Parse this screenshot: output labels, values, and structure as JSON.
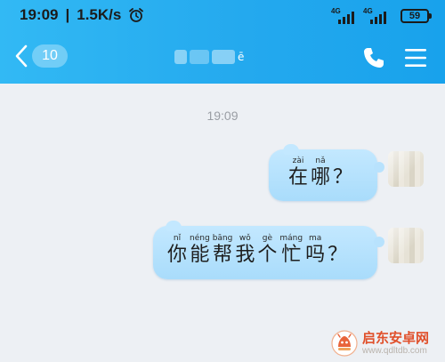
{
  "status_bar": {
    "time": "19:09",
    "speed": "1.5K/s",
    "network_1": "4G",
    "network_2": "4G",
    "battery": "59"
  },
  "title_bar": {
    "unread_count": "10",
    "contact_name_visible": "ē",
    "icons": {
      "back": "chevron-left-icon",
      "call": "phone-icon",
      "menu": "menu-icon"
    }
  },
  "chat": {
    "timestamp": "19:09",
    "messages": [
      {
        "sender": "me",
        "tokens": [
          {
            "pinyin": "zài",
            "hanzi": "在"
          },
          {
            "pinyin": "nǎ",
            "hanzi": "哪"
          },
          {
            "pinyin": "",
            "hanzi": "？"
          }
        ]
      },
      {
        "sender": "me",
        "tokens": [
          {
            "pinyin": "nǐ",
            "hanzi": "你"
          },
          {
            "pinyin": "néng",
            "hanzi": "能"
          },
          {
            "pinyin": "bāng",
            "hanzi": "帮"
          },
          {
            "pinyin": "wǒ",
            "hanzi": "我"
          },
          {
            "pinyin": "gè",
            "hanzi": "个"
          },
          {
            "pinyin": "máng",
            "hanzi": "忙"
          },
          {
            "pinyin": "ma",
            "hanzi": "吗"
          },
          {
            "pinyin": "",
            "hanzi": "？"
          }
        ]
      }
    ]
  },
  "watermark": {
    "name": "启东安卓网",
    "url": "www.qdltdb.com"
  },
  "colors": {
    "header": "#24a9ee",
    "bubble": "#b3e0fc",
    "background": "#edf0f4",
    "watermark_accent": "#e0502b"
  }
}
